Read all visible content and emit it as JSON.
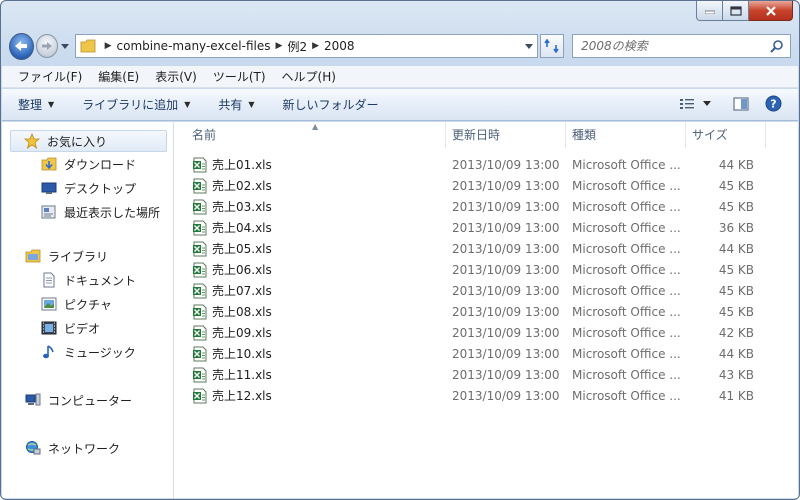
{
  "address": {
    "crumbs": [
      "combine-many-excel-files",
      "例2",
      "2008"
    ]
  },
  "search": {
    "placeholder": "2008の検索"
  },
  "menu": [
    "ファイル(F)",
    "編集(E)",
    "表示(V)",
    "ツール(T)",
    "ヘルプ(H)"
  ],
  "toolbar": {
    "organize": "整理",
    "add_to_library": "ライブラリに追加",
    "share": "共有",
    "new_folder": "新しいフォルダー"
  },
  "nav": {
    "favorites": "お気に入り",
    "downloads": "ダウンロード",
    "desktop": "デスクトップ",
    "recent": "最近表示した場所",
    "libraries": "ライブラリ",
    "documents": "ドキュメント",
    "pictures": "ピクチャ",
    "videos": "ビデオ",
    "music": "ミュージック",
    "computer": "コンピューター",
    "network": "ネットワーク"
  },
  "columns": {
    "name": "名前",
    "date": "更新日時",
    "type": "種類",
    "size": "サイズ"
  },
  "files": [
    {
      "name": "売上01.xls",
      "date": "2013/10/09 13:00",
      "type": "Microsoft Office ...",
      "size": "44 KB"
    },
    {
      "name": "売上02.xls",
      "date": "2013/10/09 13:00",
      "type": "Microsoft Office ...",
      "size": "45 KB"
    },
    {
      "name": "売上03.xls",
      "date": "2013/10/09 13:00",
      "type": "Microsoft Office ...",
      "size": "45 KB"
    },
    {
      "name": "売上04.xls",
      "date": "2013/10/09 13:00",
      "type": "Microsoft Office ...",
      "size": "36 KB"
    },
    {
      "name": "売上05.xls",
      "date": "2013/10/09 13:00",
      "type": "Microsoft Office ...",
      "size": "44 KB"
    },
    {
      "name": "売上06.xls",
      "date": "2013/10/09 13:00",
      "type": "Microsoft Office ...",
      "size": "45 KB"
    },
    {
      "name": "売上07.xls",
      "date": "2013/10/09 13:00",
      "type": "Microsoft Office ...",
      "size": "45 KB"
    },
    {
      "name": "売上08.xls",
      "date": "2013/10/09 13:00",
      "type": "Microsoft Office ...",
      "size": "45 KB"
    },
    {
      "name": "売上09.xls",
      "date": "2013/10/09 13:00",
      "type": "Microsoft Office ...",
      "size": "42 KB"
    },
    {
      "name": "売上10.xls",
      "date": "2013/10/09 13:00",
      "type": "Microsoft Office ...",
      "size": "44 KB"
    },
    {
      "name": "売上11.xls",
      "date": "2013/10/09 13:00",
      "type": "Microsoft Office ...",
      "size": "43 KB"
    },
    {
      "name": "売上12.xls",
      "date": "2013/10/09 13:00",
      "type": "Microsoft Office ...",
      "size": "41 KB"
    }
  ]
}
